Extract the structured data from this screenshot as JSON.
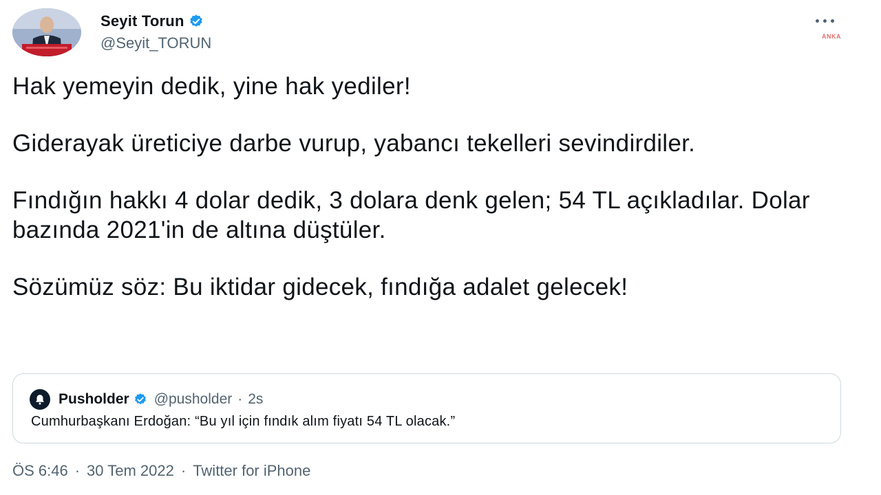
{
  "author": {
    "display_name": "Seyit Torun",
    "handle": "@Seyit_TORUN",
    "verified": true
  },
  "watermark": "ANKA",
  "tweet": {
    "paragraphs": [
      "Hak yemeyin dedik, yine hak yediler!",
      "Giderayak üreticiye darbe vurup, yabancı tekelleri sevindirdiler.",
      "Fındığın hakkı 4 dolar dedik, 3 dolara denk gelen; 54 TL açıkladılar. Dolar bazında 2021'in de altına düştüler.",
      "Sözümüz söz: Bu iktidar gidecek, fındığa adalet gelecek!"
    ]
  },
  "quoted": {
    "display_name": "Pusholder",
    "handle": "@pusholder",
    "separator": "·",
    "time": "2s",
    "text": "Cumhurbaşkanı Erdoğan: “Bu yıl için fındık alım fiyatı 54 TL olacak.”"
  },
  "footer": {
    "time": "ÖS 6:46",
    "separator": "·",
    "date": "30 Tem 2022",
    "source": "Twitter for iPhone"
  },
  "colors": {
    "verified": "#1d9bf0",
    "secondary_text": "#536471",
    "border": "#cfd9de"
  }
}
